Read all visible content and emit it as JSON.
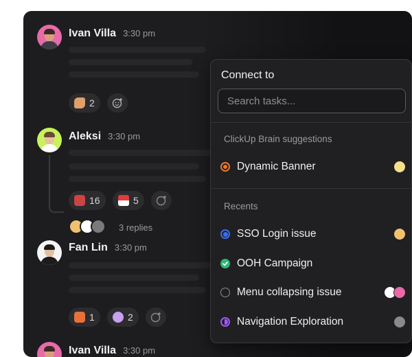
{
  "messages": [
    {
      "name": "Ivan Villa",
      "time": "3:30 pm",
      "reactions": [
        {
          "emoji": "flexed-biceps-emoji",
          "count": "2"
        }
      ]
    },
    {
      "name": "Aleksi",
      "time": "3:30 pm",
      "reactions": [
        {
          "emoji": "rocket-emoji",
          "count": "16"
        },
        {
          "emoji": "indonesia-flag-emoji",
          "count": "5"
        }
      ],
      "replies": "3 replies"
    },
    {
      "name": "Fan Lin",
      "time": "3:30 pm",
      "reactions": [
        {
          "emoji": "gift-emoji",
          "count": "1"
        },
        {
          "emoji": "unicorn-emoji",
          "count": "2"
        }
      ]
    },
    {
      "name": "Ivan Villa",
      "time": "3:30 pm"
    }
  ],
  "popover": {
    "title": "Connect to",
    "search_placeholder": "Search tasks...",
    "suggestions_label": "ClickUp Brain suggestions",
    "suggestions": [
      {
        "name": "Dynamic Banner",
        "status_color": "#f2762e",
        "status_icon": "in-progress-icon"
      }
    ],
    "recents_label": "Recents",
    "recents": [
      {
        "name": "SSO Login issue",
        "status_color": "#3b6cf6",
        "status_icon": "filled-circle-icon"
      },
      {
        "name": "OOH Campaign",
        "status_color": "#2eb872",
        "status_icon": "check-circle-icon"
      },
      {
        "name": "Menu collapsing issue",
        "status_color": "#8e8e93",
        "status_icon": "empty-circle-icon"
      },
      {
        "name": "Navigation Exploration",
        "status_color": "#a259ff",
        "status_icon": "review-circle-icon"
      }
    ]
  },
  "colors": {
    "background": "#1d1d1f",
    "popover": "#202022",
    "accent_blue": "#3b6cf6",
    "accent_green": "#2eb872",
    "accent_orange": "#f2762e",
    "accent_purple": "#a259ff"
  }
}
